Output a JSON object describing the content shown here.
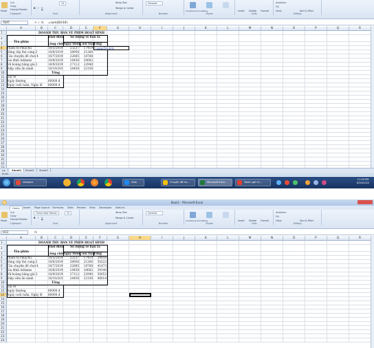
{
  "ribbon": {
    "clipboard": {
      "paste": "Paste",
      "cut": "Cut",
      "copy": "Copy",
      "format_painter": "Format Painter",
      "group": "Clipboard"
    },
    "font": {
      "name": "Times New Roman",
      "size": "12",
      "group": "Font"
    },
    "alignment": {
      "wrap": "Wrap Text",
      "merge": "Merge & Center",
      "group": "Alignment"
    },
    "number": {
      "format": "General",
      "group": "Number"
    },
    "styles": {
      "conditional": "Conditional Formatting",
      "format_table": "Format as Table",
      "cell_styles": "Cell Styles",
      "group": "Styles"
    },
    "cells": {
      "insert": "Insert",
      "delete": "Delete",
      "format": "Format",
      "group": "Cells"
    },
    "editing": {
      "autosum": "AutoSum",
      "fill": "Fill",
      "clear": "Clear",
      "sort": "Sort & Filter",
      "find": "Find & Select",
      "group": "Editing"
    }
  },
  "tabs": [
    "Home",
    "Insert",
    "Page Layout",
    "Formulas",
    "Data",
    "Review",
    "View",
    "Developer",
    "Add-Ins"
  ],
  "columns": [
    "A",
    "B",
    "C",
    "D",
    "E",
    "F",
    "G",
    "H",
    "I",
    "J",
    "K",
    "L",
    "M",
    "N",
    "O",
    "P",
    "Q",
    "R"
  ],
  "sheet": {
    "title": "DOANH THU BÁN VÉ PHIM HOẠT HÌNH",
    "h_name": "Tên phim",
    "h_show1": "Thời điểm",
    "h_show2": "công chiếu",
    "h_sold": "Số lượng vé bán ra",
    "h_week": "Ngày thường",
    "h_weekend": "Cuối tuần",
    "h_total": "Tổng",
    "movies": [
      {
        "name": "Thám tử Pikachu",
        "date": "10/5/2019",
        "week": "23237",
        "weekend": "17419",
        "total": "39856"
      },
      {
        "name": "Đẳng cấp thú cưng 2",
        "date": "10/6/2019",
        "week": "28956",
        "weekend": "21266",
        "total": "50222"
      },
      {
        "name": "Câu chuyện đồ chơi 4",
        "date": "10/7/2019",
        "week": "22685",
        "weekend": "18788",
        "total": "41473"
      },
      {
        "name": "Gia đình Addams",
        "date": "10/8/2019",
        "week": "18458",
        "weekend": "20682",
        "total": "39140"
      },
      {
        "name": "Nữ hoàng băng giá 2",
        "date": "10/9/2019",
        "week": "27112",
        "weekend": "22940",
        "total": "50052"
      },
      {
        "name": "Điệp viên ẩn danh",
        "date": "10/10/2019",
        "week": "24458",
        "weekend": "22156",
        "total": "46614"
      }
    ],
    "total_label": "Tổng",
    "price_label": "Giá vé",
    "weekday_label": "Ngày thường",
    "weekday_price": "60000 đ",
    "weekend_label": "Ngày cuối tuần, Ngày lễ",
    "weekend_price": "80000 đ"
  },
  "top": {
    "namebox": "TEXT",
    "formula": "=sum(D4:E4)",
    "cell_edit": "=sum(D4:E4)",
    "sheets": [
      "Sheet1",
      "Sheet2",
      "Sheet3"
    ],
    "status": "Enter",
    "taskbar": [
      "vietpack",
      "Zalo",
      "Chuyện đề ha...",
      "Microsoft Exce...",
      "Tamin gái ch..."
    ],
    "clock_time": "11:09 PM",
    "clock_date": "6/30/2022"
  },
  "bottom": {
    "window_title": "Book1 - Microsoft Excel",
    "namebox": "H13",
    "formula": ""
  }
}
